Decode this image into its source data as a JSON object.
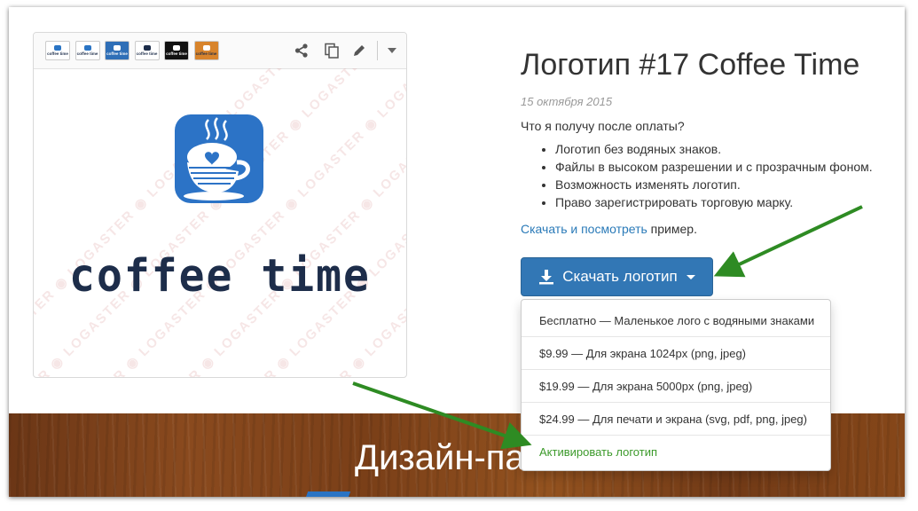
{
  "thumbnails": [
    {
      "name": "thumb-white-1",
      "bg": "#ffffff",
      "cup": "#2a74c4",
      "text": "#1d2d4a",
      "label": "coffee time"
    },
    {
      "name": "thumb-white-2",
      "bg": "#ffffff",
      "cup": "#2a74c4",
      "text": "#1d2d4a",
      "label": "coffee time"
    },
    {
      "name": "thumb-blue",
      "bg": "#2f6fb7",
      "cup": "#ffffff",
      "text": "#ffffff",
      "label": "coffee time"
    },
    {
      "name": "thumb-white-3",
      "bg": "#ffffff",
      "cup": "#1d2d4a",
      "text": "#1d2d4a",
      "label": "coffee time"
    },
    {
      "name": "thumb-black",
      "bg": "#111111",
      "cup": "#ffffff",
      "text": "#ffffff",
      "label": "coffee time"
    },
    {
      "name": "thumb-orange",
      "bg": "#d8842c",
      "cup": "#ffffff",
      "text": "#1d2d4a",
      "label": "coffee time"
    }
  ],
  "toolbar": {
    "icons": [
      "share-icon",
      "copy-icon",
      "edit-icon",
      "caret-down-icon"
    ]
  },
  "preview": {
    "logo_text": "coffee time",
    "watermark": "LOGASTER"
  },
  "product": {
    "title": "Логотип #17 Coffee Time",
    "date": "15 октября 2015",
    "question": "Что я получу после оплаты?",
    "features": [
      "Логотип без водяных знаков.",
      "Файлы в высоком разрешении и с прозрачным фоном.",
      "Возможность изменять логотип.",
      "Право зарегистрировать торговую марку."
    ],
    "sample_link": "Скачать и посмотреть",
    "sample_suffix": " пример."
  },
  "download": {
    "button_label": "Скачать логотип",
    "menu": [
      "Бесплатно — Маленькое лого с водяными знаками",
      "$9.99 — Для экрана 1024px (png, jpeg)",
      "$19.99 — Для экрана 5000px (png, jpeg)",
      "$24.99 — Для печати и экрана (svg, pdf, png, jpeg)",
      "Активировать логотип"
    ]
  },
  "banner": {
    "text": "Дизайн-па"
  },
  "colors": {
    "accent": "#3277b5",
    "link": "#2a7ab8",
    "activate": "#3c9a2b",
    "arrow": "#2e8b23"
  }
}
